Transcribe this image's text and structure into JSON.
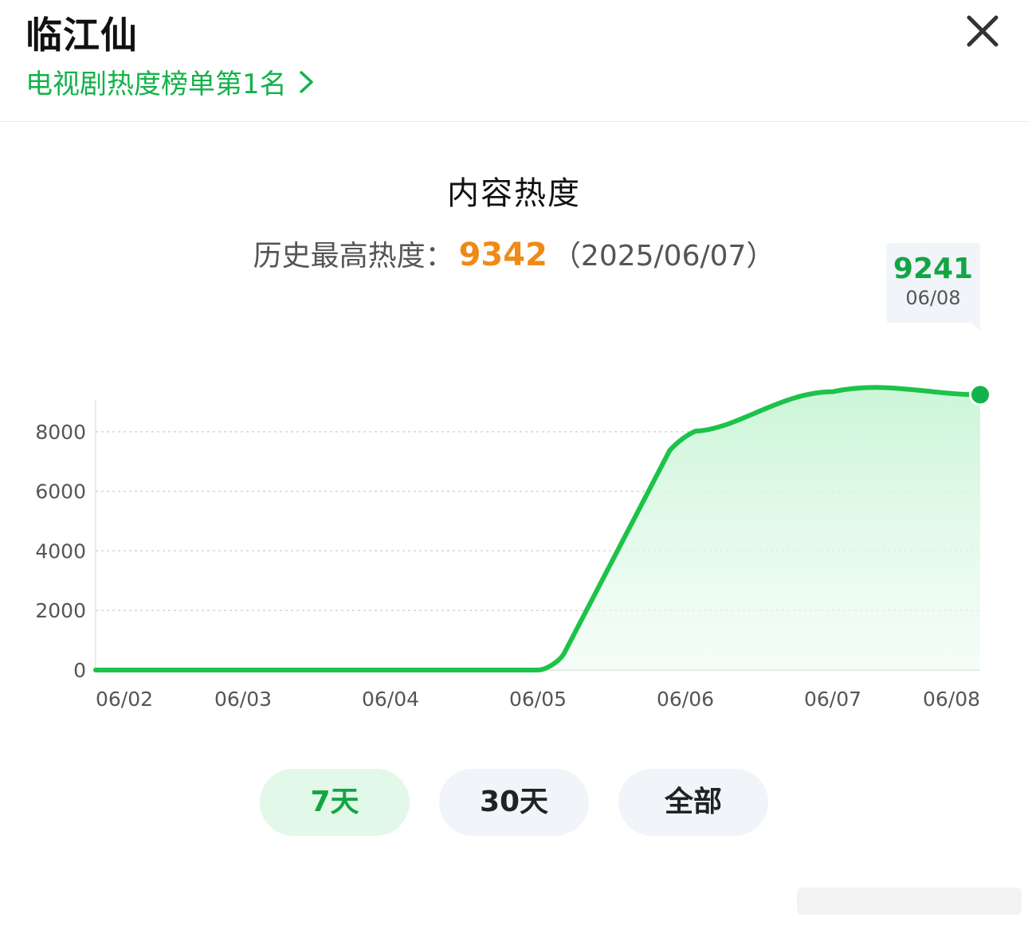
{
  "header": {
    "title": "临江仙",
    "rank_link": "电视剧热度榜单第1名"
  },
  "section": {
    "title": "内容热度",
    "record_label": "历史最高热度：",
    "record_value": "9342",
    "record_date": "（2025/06/07）"
  },
  "tooltip": {
    "value": "9241",
    "date": "06/08"
  },
  "range_buttons": [
    {
      "label": "7天",
      "active": true
    },
    {
      "label": "30天",
      "active": false
    },
    {
      "label": "全部",
      "active": false
    }
  ],
  "colors": {
    "accent": "#13b24a",
    "line": "#1cc349",
    "peak": "#f08a16"
  },
  "icons": [
    "close-icon",
    "chevron-right-icon"
  ],
  "chart_data": {
    "type": "area",
    "x": [
      "06/02",
      "06/03",
      "06/04",
      "06/05",
      "06/06",
      "06/07",
      "06/08"
    ],
    "series": [
      {
        "values": [
          0,
          0,
          0,
          0,
          7700,
          9342,
          9241
        ]
      }
    ],
    "yticks": [
      0,
      2000,
      4000,
      6000,
      8000
    ],
    "ylim": [
      0,
      9600
    ],
    "grid": true,
    "highlight": {
      "x": "06/08",
      "value": 9241
    }
  }
}
